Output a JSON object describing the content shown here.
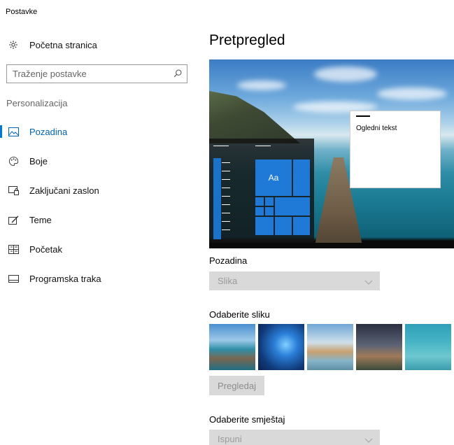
{
  "app": {
    "title": "Postavke"
  },
  "nav": {
    "home_label": "Početna stranica",
    "search_placeholder": "Traženje postavke",
    "section_label": "Personalizacija",
    "items": [
      {
        "label": "Pozadina",
        "icon": "picture-icon",
        "active": true
      },
      {
        "label": "Boje",
        "icon": "palette-icon",
        "active": false
      },
      {
        "label": "Zaključani zaslon",
        "icon": "lock-screen-icon",
        "active": false
      },
      {
        "label": "Teme",
        "icon": "theme-brush-icon",
        "active": false
      },
      {
        "label": "Početak",
        "icon": "start-tiles-icon",
        "active": false
      },
      {
        "label": "Programska traka",
        "icon": "taskbar-icon",
        "active": false
      }
    ]
  },
  "main": {
    "title": "Pretpregled",
    "preview": {
      "tile_text": "Aa",
      "window_text": "Ogledni tekst"
    },
    "background": {
      "label": "Pozadina",
      "value": "Slika"
    },
    "choose_picture": {
      "label": "Odaberite sliku"
    },
    "browse_button": "Pregledaj",
    "fit": {
      "label": "Odaberite smještaj",
      "value": "Ispuni"
    }
  },
  "colors": {
    "accent": "#0078d7",
    "active_text": "#0063b1",
    "disabled_bg": "#d9d9d9"
  }
}
